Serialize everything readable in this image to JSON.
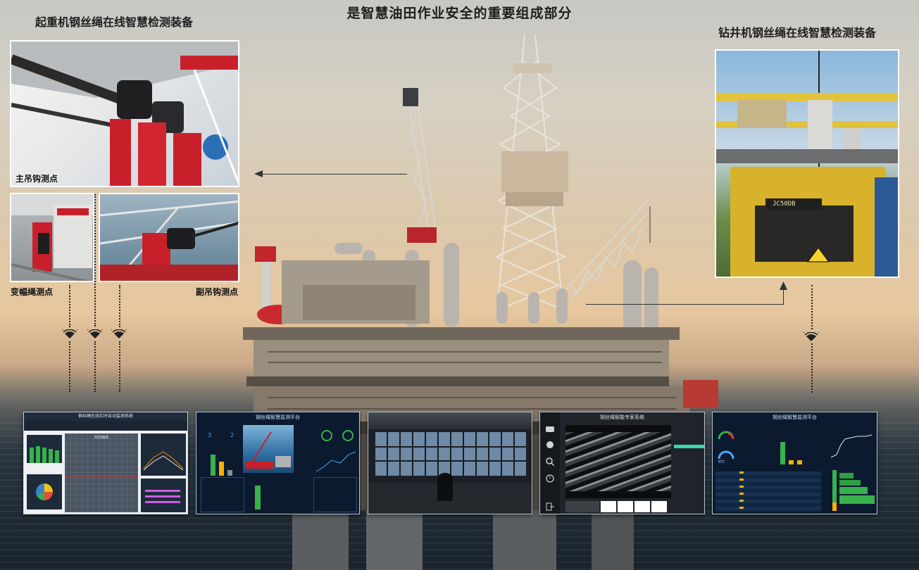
{
  "titles": {
    "main": "是智慧油田作业安全的重要组成部分",
    "left": "起重机钢丝绳在线智慧检测装备",
    "right": "钻井机钢丝绳在线智慧检测装备"
  },
  "labels": {
    "main_hook": "主吊钩测点",
    "luffing_rope": "变幅绳测点",
    "aux_hook": "副吊钩测点"
  },
  "photo_text": {
    "plate": "JC50DB"
  },
  "screens": {
    "s1_title": "钢丝绳在线实时自动监测系统",
    "s1_center": "实时曲线",
    "s2_title": "钢丝绳智慧监测平台",
    "s2_v1": "3",
    "s2_v2": "2",
    "s4_title": "钢丝绳智能专家系统",
    "s5_title": "钢丝绳智慧监测平台",
    "s5_gauge": "BTC"
  },
  "colors": {
    "crane_red": "#c8202a",
    "screen_bg": "#0b1a2e",
    "accent_green": "#37b24d"
  }
}
